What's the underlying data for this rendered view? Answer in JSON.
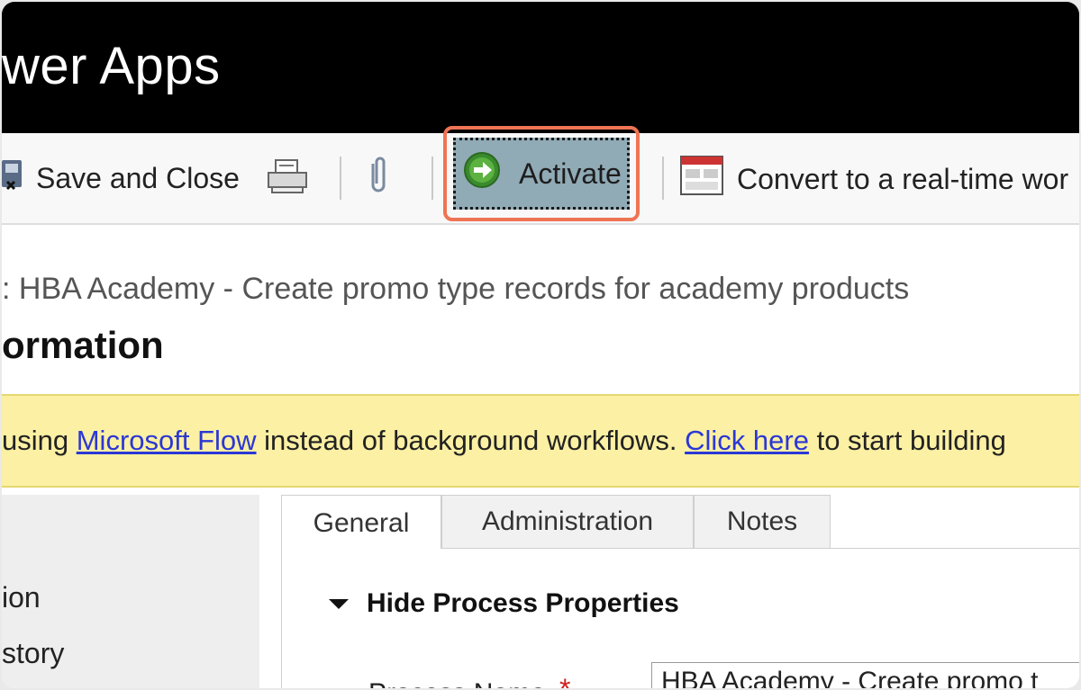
{
  "app": {
    "title": "wer Apps"
  },
  "toolbar": {
    "save_close_label": "Save and Close",
    "activate_label": "Activate",
    "convert_label": "Convert to a real-time wor",
    "icons": [
      "save-close-icon",
      "print-icon",
      "attach-icon",
      "activate-icon",
      "convert-icon"
    ]
  },
  "header": {
    "breadcrumb": ": HBA Academy - Create promo type records for academy products",
    "title": "ormation"
  },
  "notice": {
    "prefix": "using ",
    "link1": "Microsoft Flow",
    "middle": " instead of background workflows. ",
    "link2": "Click here",
    "suffix": " to start building"
  },
  "leftnav": {
    "items": [
      "ion",
      "story"
    ]
  },
  "tabs": [
    "General",
    "Administration",
    "Notes"
  ],
  "section": {
    "title": "Hide Process Properties"
  },
  "form": {
    "process_name_label": "Process Name",
    "required_marker": "*",
    "process_name_value": "HBA Academy - Create promo t"
  },
  "colors": {
    "highlight": "#ef7454",
    "activate_bg": "#90aab6",
    "notice_bg": "#fbf0a3",
    "link": "#2b37d6"
  }
}
